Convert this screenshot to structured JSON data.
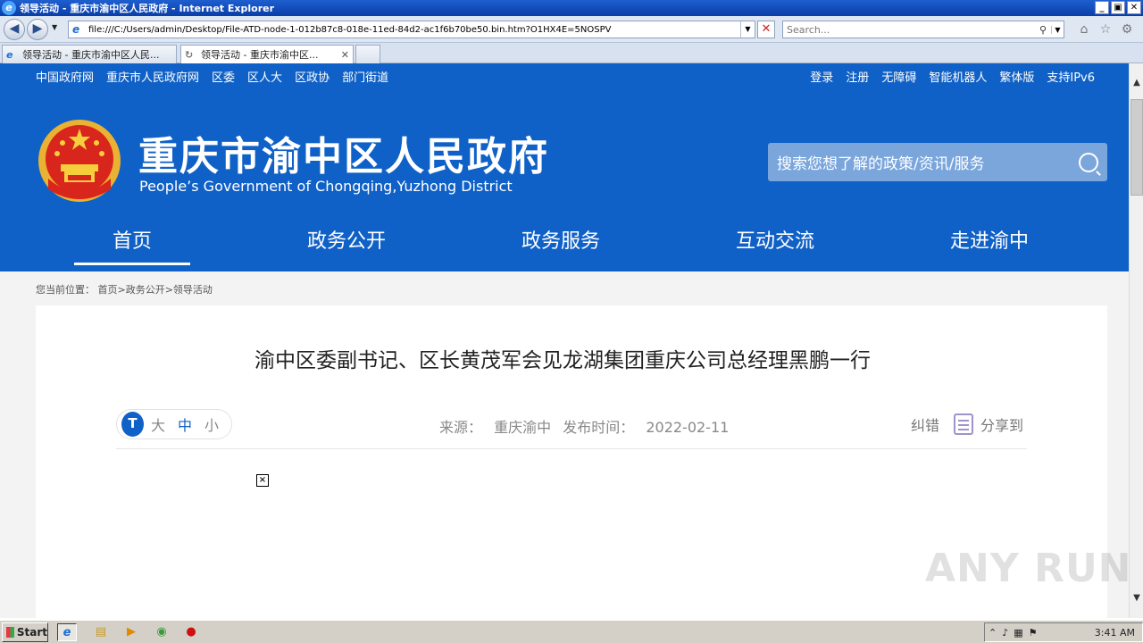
{
  "window": {
    "title": "领导活动 - 重庆市渝中区人民政府 - Internet Explorer",
    "buttons": [
      "_",
      "▣",
      "✕"
    ]
  },
  "addressbar": {
    "url": "file:///C:/Users/admin/Desktop/File-ATD-node-1-012b87c8-018e-11ed-84d2-ac1f6b70be50.bin.htm?O1HX4E=5NOSPV",
    "search_placeholder": "Search..."
  },
  "tabs": [
    {
      "label": "领导活动 - 重庆市渝中区人民...",
      "active": false
    },
    {
      "label": "领导活动 - 重庆市渝中区...",
      "active": true
    }
  ],
  "site": {
    "top_links_left": [
      "中国政府网",
      "重庆市人民政府网",
      "区委",
      "区人大",
      "区政协",
      "部门街道"
    ],
    "top_links_right": [
      "登录",
      "注册",
      "无障碍",
      "智能机器人",
      "繁体版",
      "支持IPv6"
    ],
    "name_cn": "重庆市渝中区人民政府",
    "name_en": "People’s Government of Chongqing,Yuzhong District",
    "search_placeholder": "搜索您想了解的政策/资讯/服务",
    "nav": [
      "首页",
      "政务公开",
      "政务服务",
      "互动交流",
      "走进渝中"
    ],
    "nav_active": "首页"
  },
  "breadcrumb": "您当前位置： 首页>政务公开>领导活动",
  "article": {
    "title": "渝中区委副书记、区长黄茂军会见龙湖集团重庆公司总经理黑鹏一行",
    "font_sizes": [
      "大",
      "中",
      "小"
    ],
    "font_icon": "T",
    "source_label": "来源：",
    "source": "重庆渝中",
    "date_label": "发布时间：",
    "date": "2022-02-11",
    "correction": "纠错",
    "share": "分享到"
  },
  "watermark": "ANY RUN",
  "taskbar": {
    "start": "Start",
    "clock": "3:41 AM"
  },
  "colors": {
    "brand_blue": "#1061c7",
    "search_bg": "#7aa6dc"
  }
}
